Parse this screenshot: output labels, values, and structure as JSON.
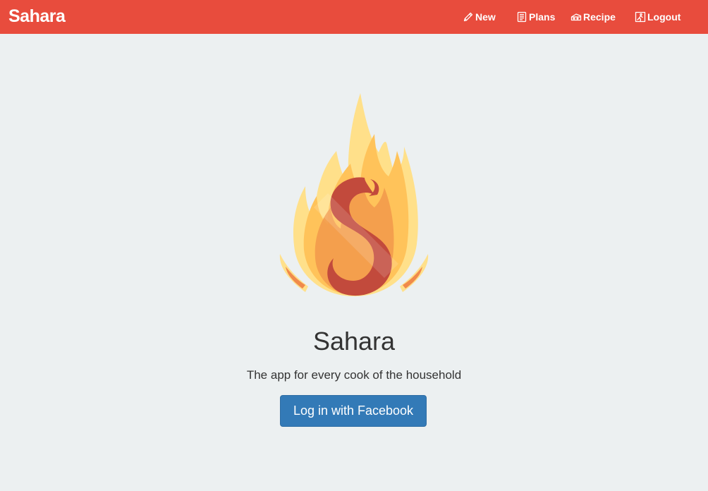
{
  "navbar": {
    "brand": "Sahara",
    "links": [
      {
        "label": "New",
        "icon": "pencil-icon"
      },
      {
        "label": "Plans",
        "icon": "document-list-icon"
      },
      {
        "label": "Recipe",
        "icon": "recipe-icon"
      },
      {
        "label": "Logout",
        "icon": "logout-icon"
      }
    ]
  },
  "main": {
    "logo_icon": "flame-s-logo",
    "title": "Sahara",
    "tagline": "The app for every cook of the household",
    "login_button": "Log in with Facebook"
  },
  "colors": {
    "navbar_bg": "#e84c3d",
    "page_bg": "#ecf0f1",
    "button_bg": "#337ab7",
    "flame_outer": "#ffe08a",
    "flame_mid": "#ffc35a",
    "flame_inner": "#f39b4b",
    "s_mark": "#c24a3c"
  }
}
